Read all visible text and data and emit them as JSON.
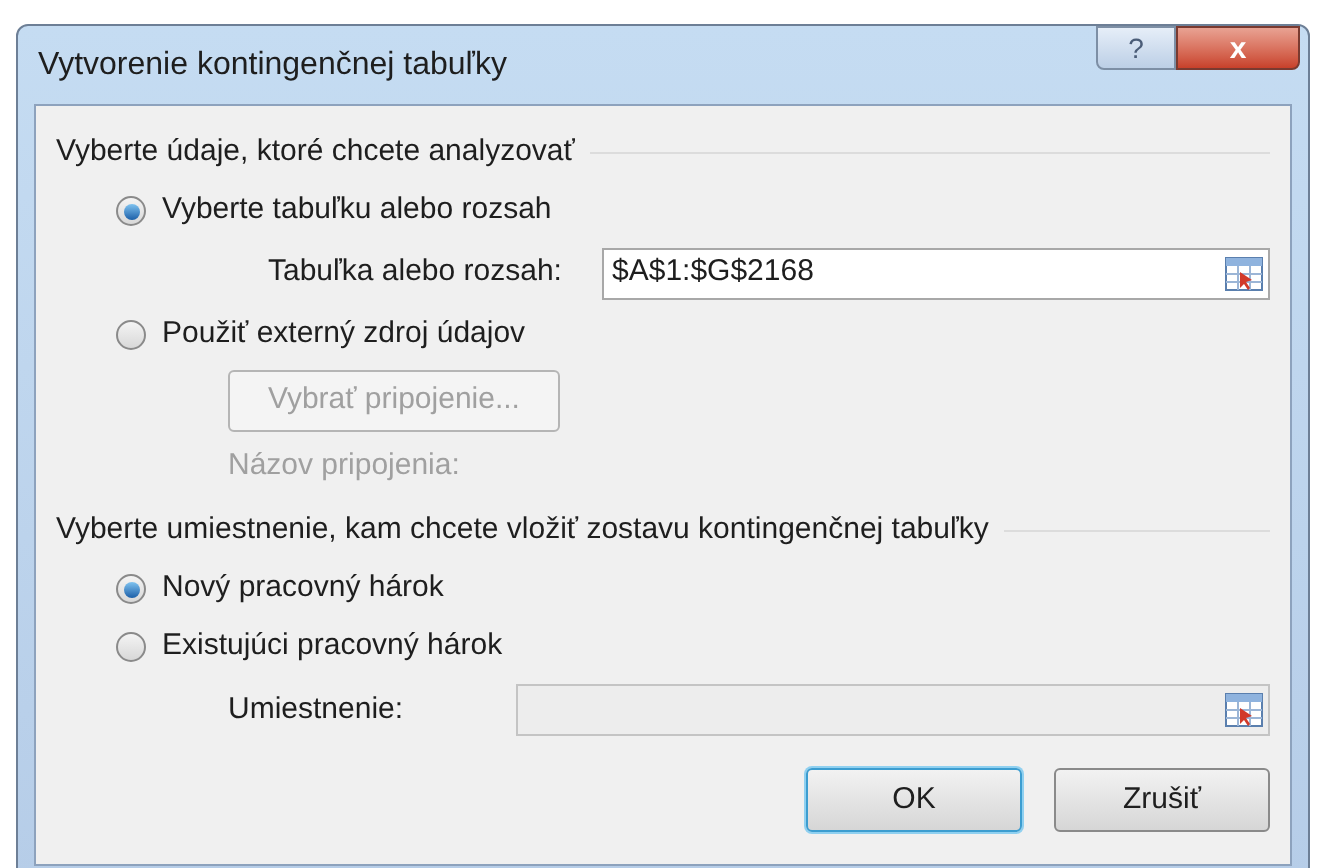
{
  "window": {
    "title": "Vytvorenie kontingenčnej tabuľky",
    "help_button": "?",
    "close_button": "x"
  },
  "source_section": {
    "heading": "Vyberte údaje, ktoré chcete analyzovať",
    "options": [
      {
        "label": "Vyberte tabuľku alebo rozsah",
        "selected": true
      },
      {
        "label": "Použiť externý zdroj údajov",
        "selected": false
      }
    ],
    "range_field": {
      "label": "Tabuľka alebo rozsah:",
      "value": "$A$1:$G$2168"
    },
    "connection_button": {
      "label": "Vybrať pripojenie...",
      "disabled": true
    },
    "connection_name": {
      "label": "Názov pripojenia:",
      "disabled": true
    }
  },
  "destination_section": {
    "heading": "Vyberte umiestnenie, kam chcete vložiť zostavu kontingenčnej tabuľky",
    "options": [
      {
        "label": "Nový pracovný hárok",
        "selected": true
      },
      {
        "label": "Existujúci pracovný hárok",
        "selected": false
      }
    ],
    "location_field": {
      "label": "Umiestnenie:",
      "disabled": true
    }
  },
  "buttons": [
    {
      "label": "OK",
      "default": true
    },
    {
      "label": "Zrušiť",
      "default": false
    }
  ]
}
